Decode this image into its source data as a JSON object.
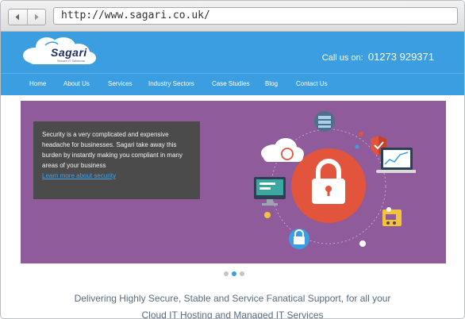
{
  "browser": {
    "url": "http://www.sagari.co.uk/",
    "back_icon": "chevron-left-icon",
    "forward_icon": "chevron-right-icon"
  },
  "header": {
    "logo_text": "Sagari",
    "logo_tagline": "Secure IT Solutions",
    "call_label": "Call us on:",
    "phone": "01273 929371"
  },
  "nav": {
    "items": [
      {
        "label": "Home"
      },
      {
        "label": "About Us"
      },
      {
        "label": "Services"
      },
      {
        "label": "Industry Sectors"
      },
      {
        "label": "Case Studies"
      },
      {
        "label": "Blog"
      },
      {
        "label": "Contact Us"
      }
    ]
  },
  "slider": {
    "text": "Security is a very complicated and expensive headache for businesses. Sagari take away this burden by instantly making you compliant in many areas of your business",
    "link": "Learn more about security",
    "active_slide": 2,
    "slide_count": 3
  },
  "tagline": {
    "line1": "Delivering Highly Secure, Stable and Service Fanatical Support, for all your",
    "line2": "Cloud IT Hosting and Managed IT Services"
  },
  "colors": {
    "brand_blue": "#3a9ee1",
    "slide_purple": "#8f5b9b",
    "lock_red": "#e2543b"
  }
}
